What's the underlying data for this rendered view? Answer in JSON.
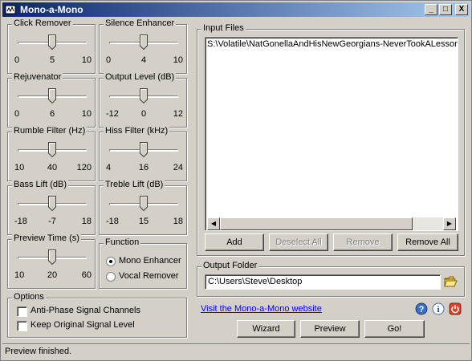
{
  "window": {
    "title": "Mono-a-Mono",
    "minimize": "_",
    "maximize": "□",
    "close": "X"
  },
  "sliders": [
    {
      "label": "Click Remover",
      "ticks": [
        "0",
        "5",
        "10"
      ],
      "value": 5,
      "min": 0,
      "max": 10
    },
    {
      "label": "Silence Enhancer",
      "ticks": [
        "0",
        "4",
        "10"
      ],
      "value": 4,
      "min": 0,
      "max": 10
    },
    {
      "label": "Rejuvenator",
      "ticks": [
        "0",
        "6",
        "10"
      ],
      "value": 6,
      "min": 0,
      "max": 10
    },
    {
      "label": "Output Level (dB)",
      "ticks": [
        "-12",
        "0",
        "12"
      ],
      "value": 0,
      "min": -12,
      "max": 12
    },
    {
      "label": "Rumble Filter (Hz)",
      "ticks": [
        "10",
        "40",
        "120"
      ],
      "value": 40,
      "min": 10,
      "max": 120
    },
    {
      "label": "Hiss Filter (kHz)",
      "ticks": [
        "4",
        "16",
        "24"
      ],
      "value": 16,
      "min": 4,
      "max": 24
    },
    {
      "label": "Bass Lift (dB)",
      "ticks": [
        "-18",
        "-7",
        "18"
      ],
      "value": -7,
      "min": -18,
      "max": 18
    },
    {
      "label": "Treble Lift (dB)",
      "ticks": [
        "-18",
        "15",
        "18"
      ],
      "value": 15,
      "min": -18,
      "max": 18
    },
    {
      "label": "Preview Time (s)",
      "ticks": [
        "10",
        "20",
        "60"
      ],
      "value": 20,
      "min": 10,
      "max": 60
    }
  ],
  "function": {
    "label": "Function",
    "options": [
      "Mono Enhancer",
      "Vocal Remover"
    ],
    "selected": "Mono Enhancer"
  },
  "options": {
    "label": "Options",
    "items": [
      {
        "label": "Anti-Phase Signal Channels",
        "checked": false
      },
      {
        "label": "Keep Original Signal Level",
        "checked": false
      }
    ]
  },
  "input_files": {
    "label": "Input Files",
    "items": [
      "S:\\Volatile\\NatGonellaAndHisNewGeorgians-NeverTookALessonIr"
    ],
    "buttons": {
      "add": "Add",
      "deselect_all": "Deselect All",
      "remove": "Remove",
      "remove_all": "Remove All"
    }
  },
  "output_folder": {
    "label": "Output Folder",
    "value": "C:\\Users\\Steve\\Desktop"
  },
  "website_link": "Visit the Mono-a-Mono website",
  "actions": {
    "wizard": "Wizard",
    "preview": "Preview",
    "go": "Go!"
  },
  "status": "Preview finished."
}
